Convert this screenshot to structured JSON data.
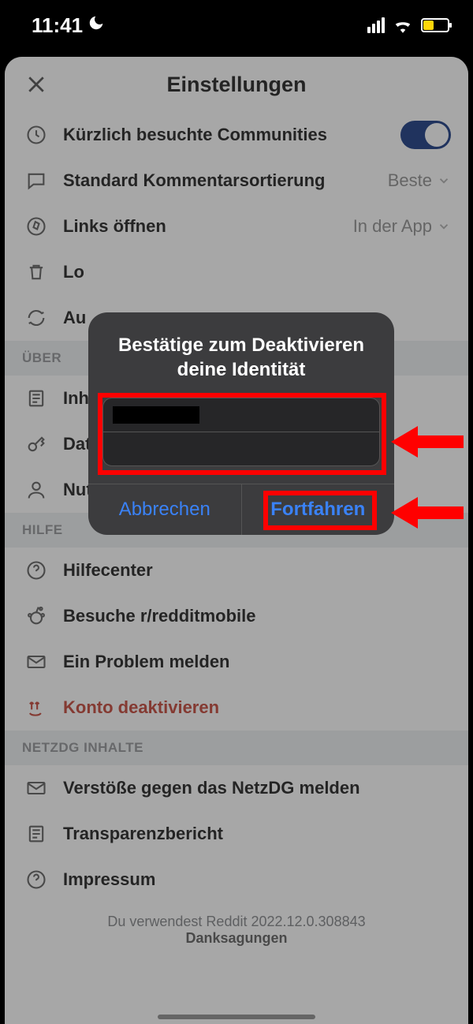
{
  "status": {
    "time": "11:41"
  },
  "header": {
    "title": "Einstellungen"
  },
  "rows": {
    "recent": {
      "label": "Kürzlich besuchte Communities"
    },
    "comments": {
      "label": "Standard Kommentarsortierung",
      "value": "Beste"
    },
    "links": {
      "label": "Links öffnen",
      "value": "In der App"
    },
    "lo": {
      "label": "Lo"
    },
    "au": {
      "label": "Au"
    },
    "inh": {
      "label": "Inh"
    },
    "dat": {
      "label": "Dat"
    },
    "terms": {
      "label": "Nutzungsbedingungen"
    },
    "help": {
      "label": "Hilfecenter"
    },
    "subreddit": {
      "label": "Besuche r/redditmobile"
    },
    "report": {
      "label": "Ein Problem melden"
    },
    "deactivate": {
      "label": "Konto deaktivieren"
    },
    "netzdg": {
      "label": "Verstöße gegen das NetzDG melden"
    },
    "transparency": {
      "label": "Transparenzbericht"
    },
    "impressum": {
      "label": "Impressum"
    }
  },
  "sections": {
    "about": "ÜBER",
    "help": "HILFE",
    "netzdg": "NETZDG INHALTE"
  },
  "footer": {
    "version": "Du verwendest Reddit 2022.12.0.308843",
    "thanks": "Danksagungen"
  },
  "modal": {
    "title": "Bestätige zum Deaktivieren deine Identität",
    "cancel": "Abbrechen",
    "continue": "Fortfahren"
  }
}
